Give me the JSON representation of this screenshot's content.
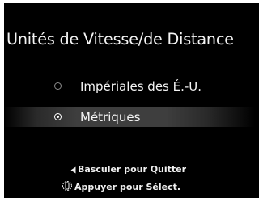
{
  "screen": {
    "title": "Unités de Vitesse/de Distance",
    "options": [
      {
        "label": "Impériales des É.-U.",
        "selected": false
      },
      {
        "label": "Métriques",
        "selected": true
      }
    ],
    "hints": {
      "back": "Basculer pour Quitter",
      "select": "Appuyer pour Sélect."
    },
    "icons": {
      "back": "left-triangle-icon",
      "select": "dial-press-icon"
    }
  }
}
